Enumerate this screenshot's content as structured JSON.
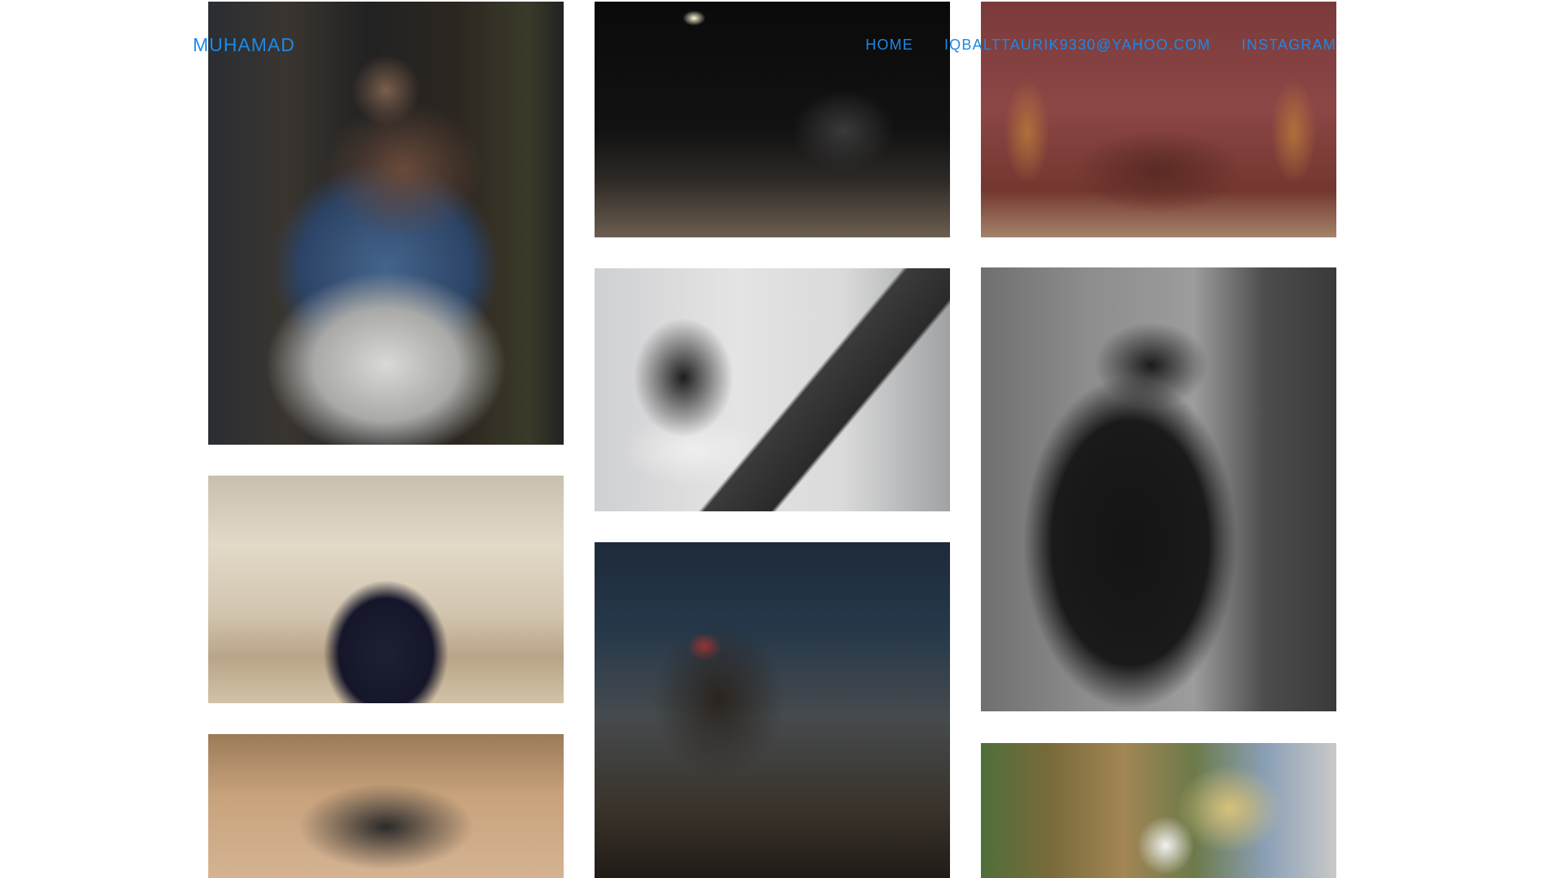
{
  "site": {
    "brand": "MUHAMAD"
  },
  "nav": {
    "items": [
      {
        "label": "HOME"
      },
      {
        "label": "IQBALTTAURIK9330@YAHOO.COM"
      },
      {
        "label": "INSTAGRAM"
      }
    ]
  },
  "gallery": {
    "photos": [
      {
        "subject": "elderly-man-with-cart-at-night"
      },
      {
        "subject": "couple-in-front-of-mansion"
      },
      {
        "subject": "man-in-cap-portrait"
      },
      {
        "subject": "man-leaning-on-car-at-night"
      },
      {
        "subject": "woman-by-window"
      },
      {
        "subject": "man-sweeping-with-broom"
      },
      {
        "subject": "man-sitting-on-leather-sofa"
      },
      {
        "subject": "man-in-hoodie-and-sunglasses"
      },
      {
        "subject": "mural-with-marshmello-figure"
      }
    ]
  }
}
